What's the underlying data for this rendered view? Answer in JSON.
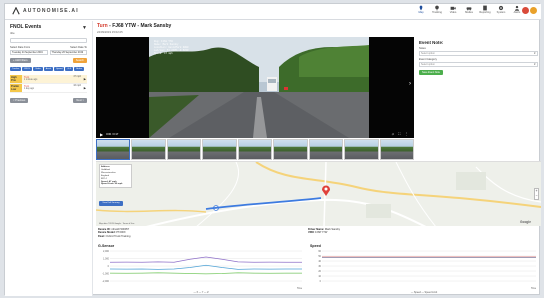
{
  "app": {
    "brand": "AUTONOMISE.AI",
    "nav": [
      {
        "label": "Map",
        "icon": "map-pin-icon"
      },
      {
        "label": "Tracking",
        "icon": "location-icon"
      },
      {
        "label": "Video",
        "icon": "video-icon"
      },
      {
        "label": "Modes",
        "icon": "car-icon"
      },
      {
        "label": "Reporting",
        "icon": "document-icon"
      },
      {
        "label": "System",
        "icon": "gear-icon"
      },
      {
        "label": "Alerts",
        "icon": "person-icon"
      }
    ]
  },
  "sidebar": {
    "title": "FNOL Events",
    "subtitle": "title",
    "date_from_label": "Select Date From",
    "date_to_label": "Select Date To",
    "date_from": "Tuesday 24 September 2019",
    "date_to": "Thursday 26 September 2019",
    "add_filter_label": "+ Add Filters",
    "search_label": "Search",
    "chips": [
      "Tracker",
      "FNOL",
      "Video",
      "Accel",
      "Speed",
      "G-F",
      "Brake"
    ],
    "events": [
      {
        "tag": "High Prio",
        "name": "Turn",
        "time": "1 minute ago",
        "speed": "47 mph"
      },
      {
        "tag": "Prelim Low",
        "name": "Turn",
        "time": "1 day ago",
        "speed": "16 mph"
      }
    ],
    "prev_label": "< Previous",
    "next_label": "Next >"
  },
  "header": {
    "event_type": "Turn",
    "title": " - FJ68 YTW - Mark Sansby",
    "date": "24/09/2019 15:02:25"
  },
  "video": {
    "overlay": [
      "Reg: FJ68 YTW",
      "Name: Mark Sansby",
      "Location: Guildford 3000",
      "Lat/Lon: 51.2405,-0.5830",
      "Speed: 47 mph"
    ],
    "time": "0:00 / 0:17"
  },
  "thumbnails": {
    "count": 9
  },
  "map": {
    "info": [
      {
        "text": "Address",
        "bold": true
      },
      {
        "text": "Guildford",
        "bold": false
      },
      {
        "text": "Worcestershire",
        "bold": false
      },
      {
        "text": "England",
        "bold": false
      },
      {
        "text": "B97 4",
        "bold": false
      },
      {
        "text": "Speed: 47 mph",
        "bold": true
      },
      {
        "text": "Speed Limit: 60 mph",
        "bold": true
      }
    ],
    "button": "View Full Journey",
    "attribution": "Map data ©2019 Google · Terms of Use",
    "google": "Google"
  },
  "details": {
    "device_id_label": "Device ID:",
    "device_id": "nthus07400057",
    "device_model_label": "Device Model:",
    "device_model": "PT200X",
    "fleet_label": "Fleet:",
    "fleet": "Oxford Truck Training",
    "driver_label": "Driver Name:",
    "driver": "Mark Sansby",
    "vrn_label": "VRN:",
    "vrn": "FJ68 YTW"
  },
  "event_note": {
    "title": "Event Note:",
    "notes_label": "Notes",
    "notes_placeholder": "Select option",
    "category_label": "Event Category",
    "category_placeholder": "Select option",
    "save_label": "Save Event Note"
  },
  "chart_data": [
    {
      "type": "line",
      "title": "G-Sensor",
      "xlabel": "Time",
      "ylim": [
        -2,
        2
      ],
      "y_ticks": [
        "2,000",
        "1,000",
        "0",
        "-1,000",
        "-2,000"
      ],
      "series": [
        {
          "name": "X",
          "color": "#8e6fc8",
          "values": [
            0.5,
            0.52,
            0.5,
            0.55,
            0.5,
            0.9,
            1.2,
            0.9,
            0.55,
            0.5,
            0.52,
            0.5,
            0.5
          ]
        },
        {
          "name": "Y",
          "color": "#4fa3d6",
          "values": [
            -0.4,
            -0.42,
            -0.4,
            -0.45,
            -0.4,
            -0.2,
            0.1,
            -0.2,
            -0.45,
            -0.4,
            -0.42,
            -0.4,
            -0.4
          ]
        },
        {
          "name": "Z",
          "color": "#7fcf6a",
          "values": [
            -0.95,
            -0.97,
            -0.95,
            -0.9,
            -0.95,
            -1.0,
            -1.05,
            -1.0,
            -0.9,
            -0.95,
            -0.97,
            -0.95,
            -0.95
          ]
        }
      ],
      "legend": "— X  — Y  — Z"
    },
    {
      "type": "line",
      "title": "Speed",
      "xlabel": "Time",
      "ylim": [
        0,
        60
      ],
      "y_ticks": [
        "60",
        "50",
        "40",
        "30",
        "20",
        "10",
        "0"
      ],
      "series": [
        {
          "name": "Speed",
          "color": "#4fa3d6",
          "values": [
            47,
            47,
            47,
            47,
            47,
            47,
            47,
            47,
            47,
            47,
            47,
            47,
            47
          ]
        },
        {
          "name": "Speed Limit",
          "color": "#e06a6a",
          "values": [
            48,
            48,
            48,
            48,
            48,
            48,
            48,
            48,
            48,
            48,
            48,
            48,
            48
          ]
        }
      ],
      "legend": "— Speed  — Speed Limit"
    }
  ]
}
